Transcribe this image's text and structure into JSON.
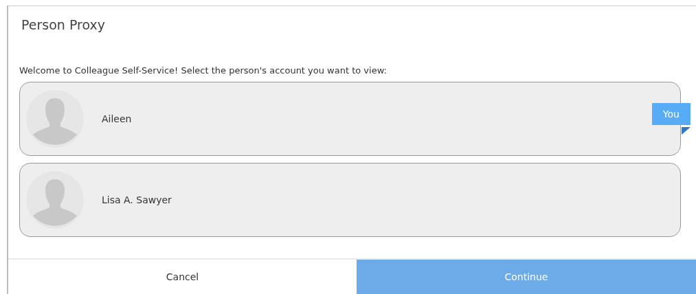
{
  "dialog": {
    "title": "Person Proxy",
    "prompt": "Welcome to Colleague Self-Service! Select the person's account you want to view:",
    "accounts": [
      {
        "name": "Aileen",
        "badge": "You"
      },
      {
        "name": "Lisa A. Sawyer"
      }
    ],
    "buttons": [
      {
        "label": "Cancel",
        "kind": "secondary"
      },
      {
        "label": "Continue",
        "kind": "primary"
      }
    ]
  }
}
